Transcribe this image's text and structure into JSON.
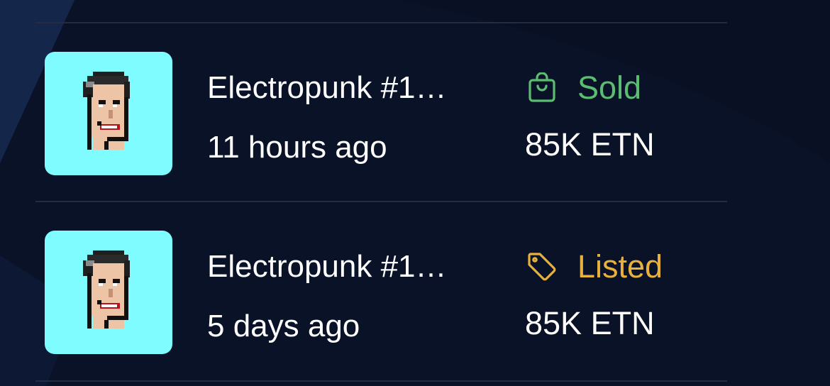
{
  "colors": {
    "sold": "#5bbd72",
    "listed": "#e8b13d",
    "thumb_bg": "#7ffcff"
  },
  "activity": {
    "items": [
      {
        "name": "Electropunk #1…",
        "time": "11 hours ago",
        "status": "Sold",
        "status_icon": "shopping-bag-icon",
        "price": "85K ETN"
      },
      {
        "name": "Electropunk #1…",
        "time": "5 days ago",
        "status": "Listed",
        "status_icon": "tag-icon",
        "price": "85K ETN"
      }
    ]
  }
}
